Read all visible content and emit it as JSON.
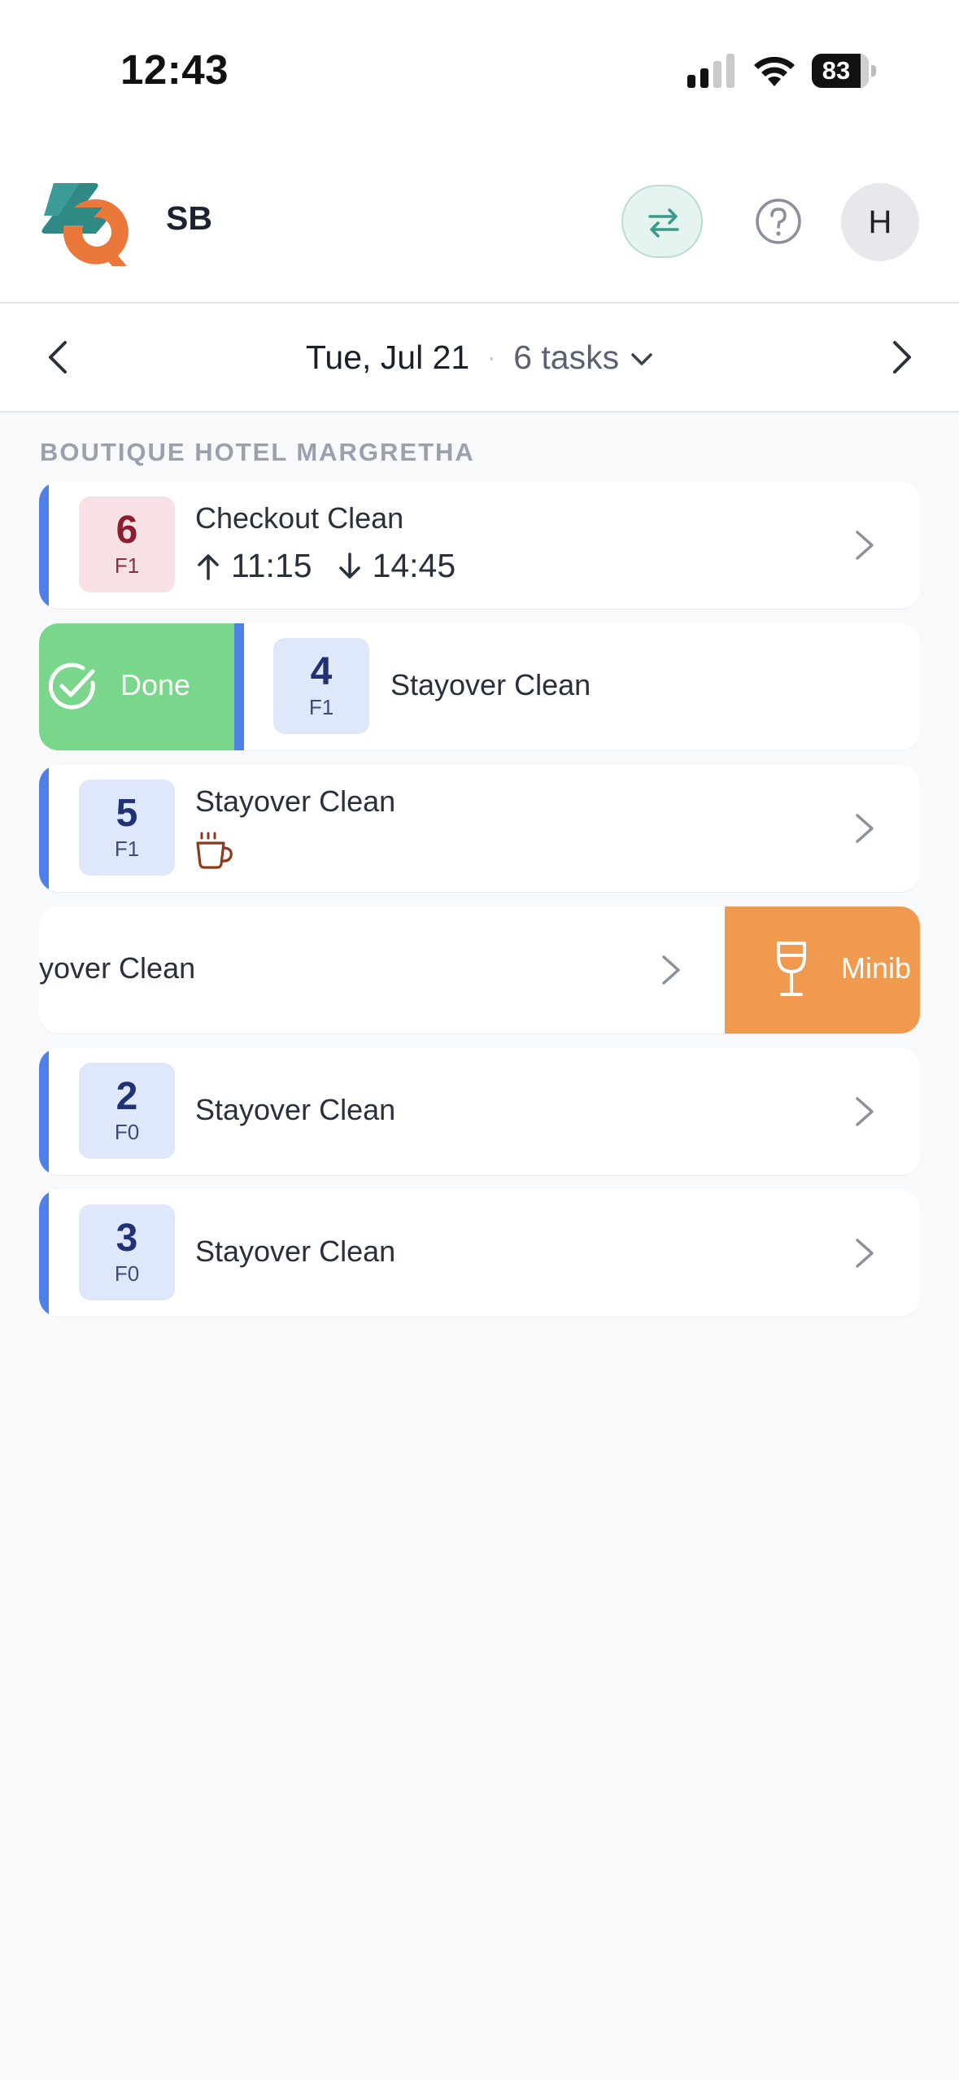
{
  "status_bar": {
    "time": "12:43",
    "battery": "83",
    "icons": [
      "cellular-signal-icon",
      "wifi-icon",
      "battery-icon"
    ]
  },
  "header": {
    "org_name": "SB",
    "avatar_initial": "H",
    "icons": [
      "app-logo",
      "switch-arrows-icon",
      "help-icon"
    ],
    "accent_color": "#3a9b8a"
  },
  "date_nav": {
    "date": "Tue, Jul 21",
    "separator": "·",
    "task_count": "6 tasks"
  },
  "property": {
    "name": "BOUTIQUE HOTEL MARGRETHA"
  },
  "tasks": [
    {
      "room": "6",
      "floor": "F1",
      "type": "Checkout Clean",
      "arrival_time": "11:15",
      "departure_time": "14:45",
      "badge_color": "#f8e1e4"
    },
    {
      "room": "4",
      "floor": "F1",
      "type": "Stayover Clean",
      "swipe_action": "Done"
    },
    {
      "room": "5",
      "floor": "F1",
      "type": "Stayover Clean",
      "extra_icon": "coffee-cup-icon"
    },
    {
      "type": "ayover Clean",
      "swipe_action": "Minib"
    },
    {
      "room": "2",
      "floor": "F0",
      "type": "Stayover Clean"
    },
    {
      "room": "3",
      "floor": "F0",
      "type": "Stayover Clean"
    }
  ],
  "colors": {
    "task_bar": "#4f80ea",
    "done_action": "#79d68a",
    "minibar_action": "#ef9a4f"
  }
}
